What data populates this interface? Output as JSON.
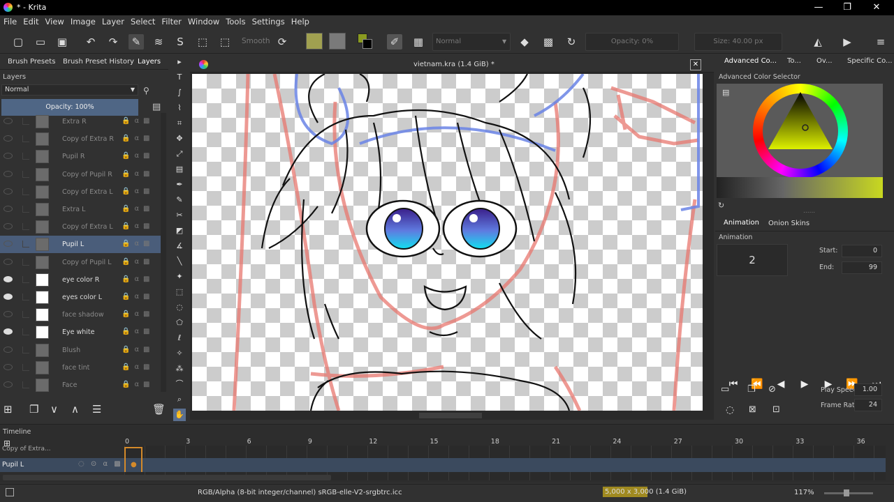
{
  "window": {
    "title": "* - Krita",
    "minimize": "—",
    "restore": "❐",
    "close": "✕"
  },
  "menu": [
    "File",
    "Edit",
    "View",
    "Image",
    "Layer",
    "Select",
    "Filter",
    "Window",
    "Tools",
    "Settings",
    "Help"
  ],
  "toolbar": {
    "smooth_label": "Smooth",
    "blend_mode": "Normal",
    "opacity": "Opacity: 0%",
    "size": "Size: 40.00 px"
  },
  "left_tabs": [
    "Brush Presets",
    "Brush Preset History",
    "Layers"
  ],
  "layers_panel": {
    "title": "Layers",
    "blend_mode": "Normal",
    "opacity": "Opacity:  100%",
    "layers": [
      {
        "name": "Extra R",
        "visible": false,
        "thumb": "gray",
        "active": false
      },
      {
        "name": "Copy of Extra R",
        "visible": false,
        "thumb": "gray",
        "active": false
      },
      {
        "name": "Pupil R",
        "visible": false,
        "thumb": "gray",
        "active": false
      },
      {
        "name": "Copy of Pupil R",
        "visible": false,
        "thumb": "gray",
        "active": false
      },
      {
        "name": "Copy of Extra L",
        "visible": false,
        "thumb": "gray",
        "active": false
      },
      {
        "name": "Extra L",
        "visible": false,
        "thumb": "gray",
        "active": false
      },
      {
        "name": "Copy of Extra L",
        "visible": false,
        "thumb": "gray",
        "active": false
      },
      {
        "name": "Pupil L",
        "visible": false,
        "thumb": "gray",
        "active": true
      },
      {
        "name": "Copy of Pupil L",
        "visible": false,
        "thumb": "gray",
        "active": false
      },
      {
        "name": "eye color R",
        "visible": true,
        "thumb": "white",
        "active": false
      },
      {
        "name": "eyes color L",
        "visible": true,
        "thumb": "white",
        "active": false
      },
      {
        "name": "face shadow",
        "visible": false,
        "thumb": "white",
        "active": false
      },
      {
        "name": "Eye white",
        "visible": true,
        "thumb": "white",
        "active": false
      },
      {
        "name": "Blush",
        "visible": false,
        "thumb": "gray",
        "active": false
      },
      {
        "name": "face tint",
        "visible": false,
        "thumb": "gray",
        "active": false
      },
      {
        "name": "Face",
        "visible": false,
        "thumb": "gray",
        "active": false
      }
    ]
  },
  "document": {
    "title": "vietnam.kra (1.4 GiB) *"
  },
  "right_tabs": [
    "Advanced Co...",
    "To...",
    "Ov...",
    "Specific Co..."
  ],
  "color_selector": {
    "title": "Advanced Color Selector"
  },
  "animation_tabs": [
    "Animation",
    "Onion Skins"
  ],
  "animation": {
    "title": "Animation",
    "current_frame": "2",
    "start_label": "Start:",
    "start": "0",
    "end_label": "End:",
    "end": "99",
    "play_speed_label": "Play Speed:",
    "play_speed": "1.00",
    "frame_rate_label": "Frame Rate:",
    "frame_rate": "24"
  },
  "timeline": {
    "title": "Timeline",
    "frame_numbers": [
      "0",
      "3",
      "6",
      "9",
      "12",
      "15",
      "18",
      "21",
      "24",
      "27",
      "30",
      "33",
      "36"
    ],
    "rows": [
      "Copy of Extra...",
      "Pupil L"
    ]
  },
  "status": {
    "color_space": "RGB/Alpha (8-bit integer/channel)  sRGB-elle-V2-srgbtrc.icc",
    "dimensions": "5,000 x 3,000 (1.4 GiB)",
    "zoom": "117%"
  }
}
